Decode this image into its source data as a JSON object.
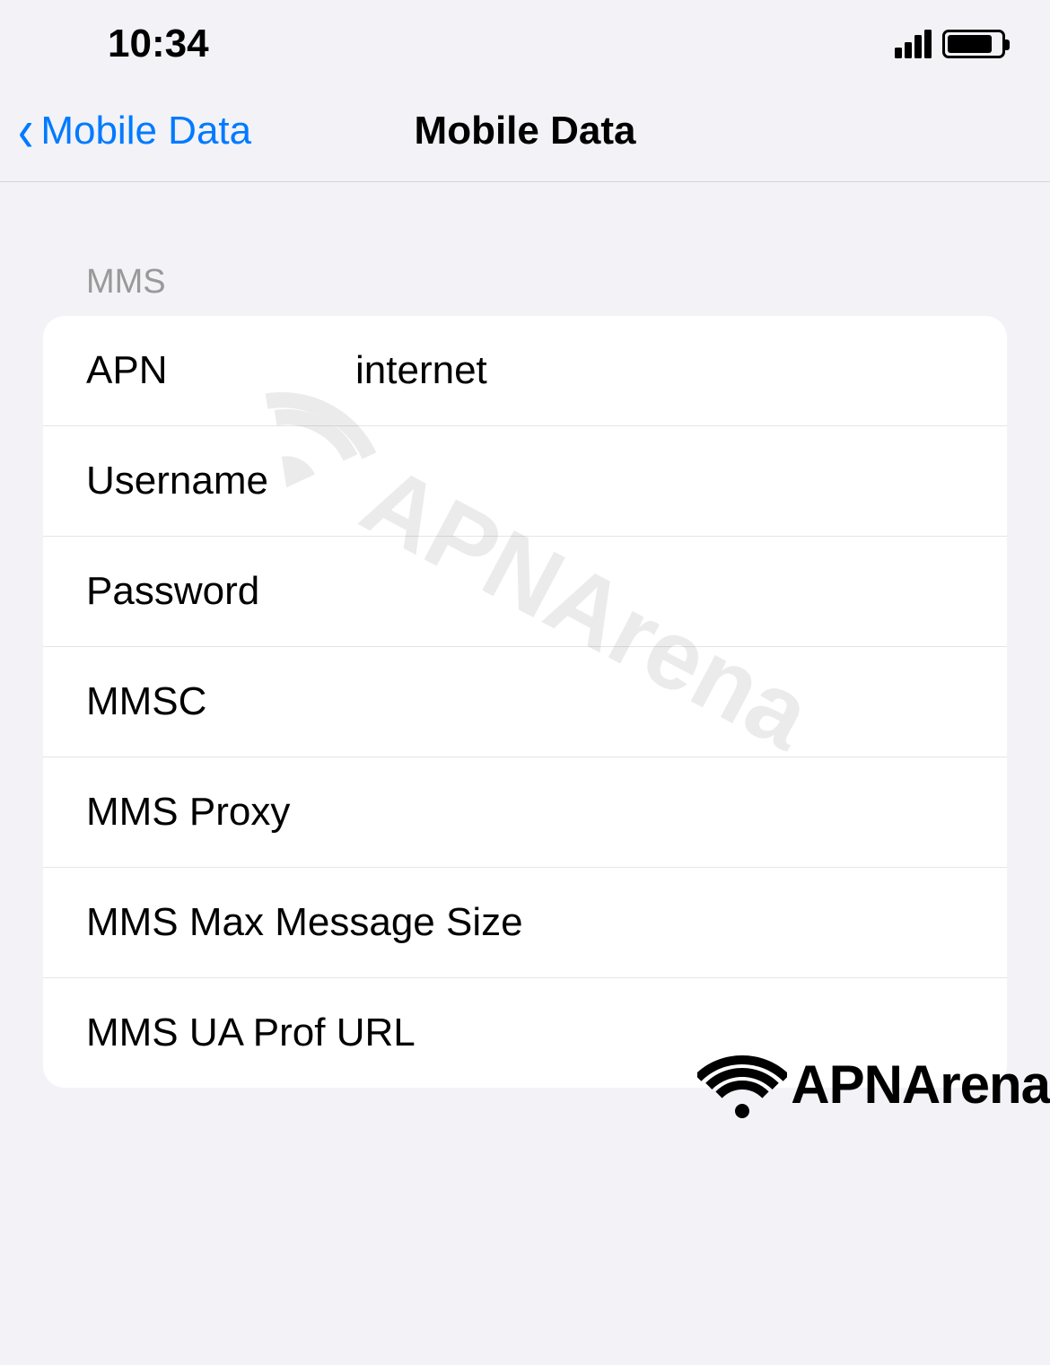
{
  "statusBar": {
    "time": "10:34"
  },
  "nav": {
    "backLabel": "Mobile Data",
    "title": "Mobile Data"
  },
  "section": {
    "header": "MMS",
    "rows": [
      {
        "label": "APN",
        "value": "internet"
      },
      {
        "label": "Username",
        "value": ""
      },
      {
        "label": "Password",
        "value": ""
      },
      {
        "label": "MMSC",
        "value": ""
      },
      {
        "label": "MMS Proxy",
        "value": ""
      },
      {
        "label": "MMS Max Message Size",
        "value": ""
      },
      {
        "label": "MMS UA Prof URL",
        "value": ""
      }
    ]
  },
  "watermark": "APNArena",
  "footerLogo": "APNArena"
}
